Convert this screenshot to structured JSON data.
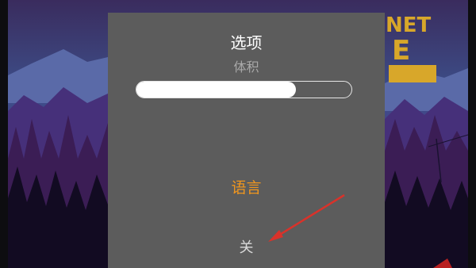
{
  "options_dialog": {
    "title": "选项",
    "volume_label": "体积",
    "volume_level": 0.74,
    "language_label": "语言",
    "close_label": "关"
  },
  "game_logo": {
    "text_line1": "NET",
    "text_line2": "E"
  },
  "colors": {
    "dialog_bg": "#5c5c5c",
    "language_accent": "#f0961e",
    "logo_yellow": "#d8a72a",
    "annotation_arrow": "#d9322a"
  }
}
